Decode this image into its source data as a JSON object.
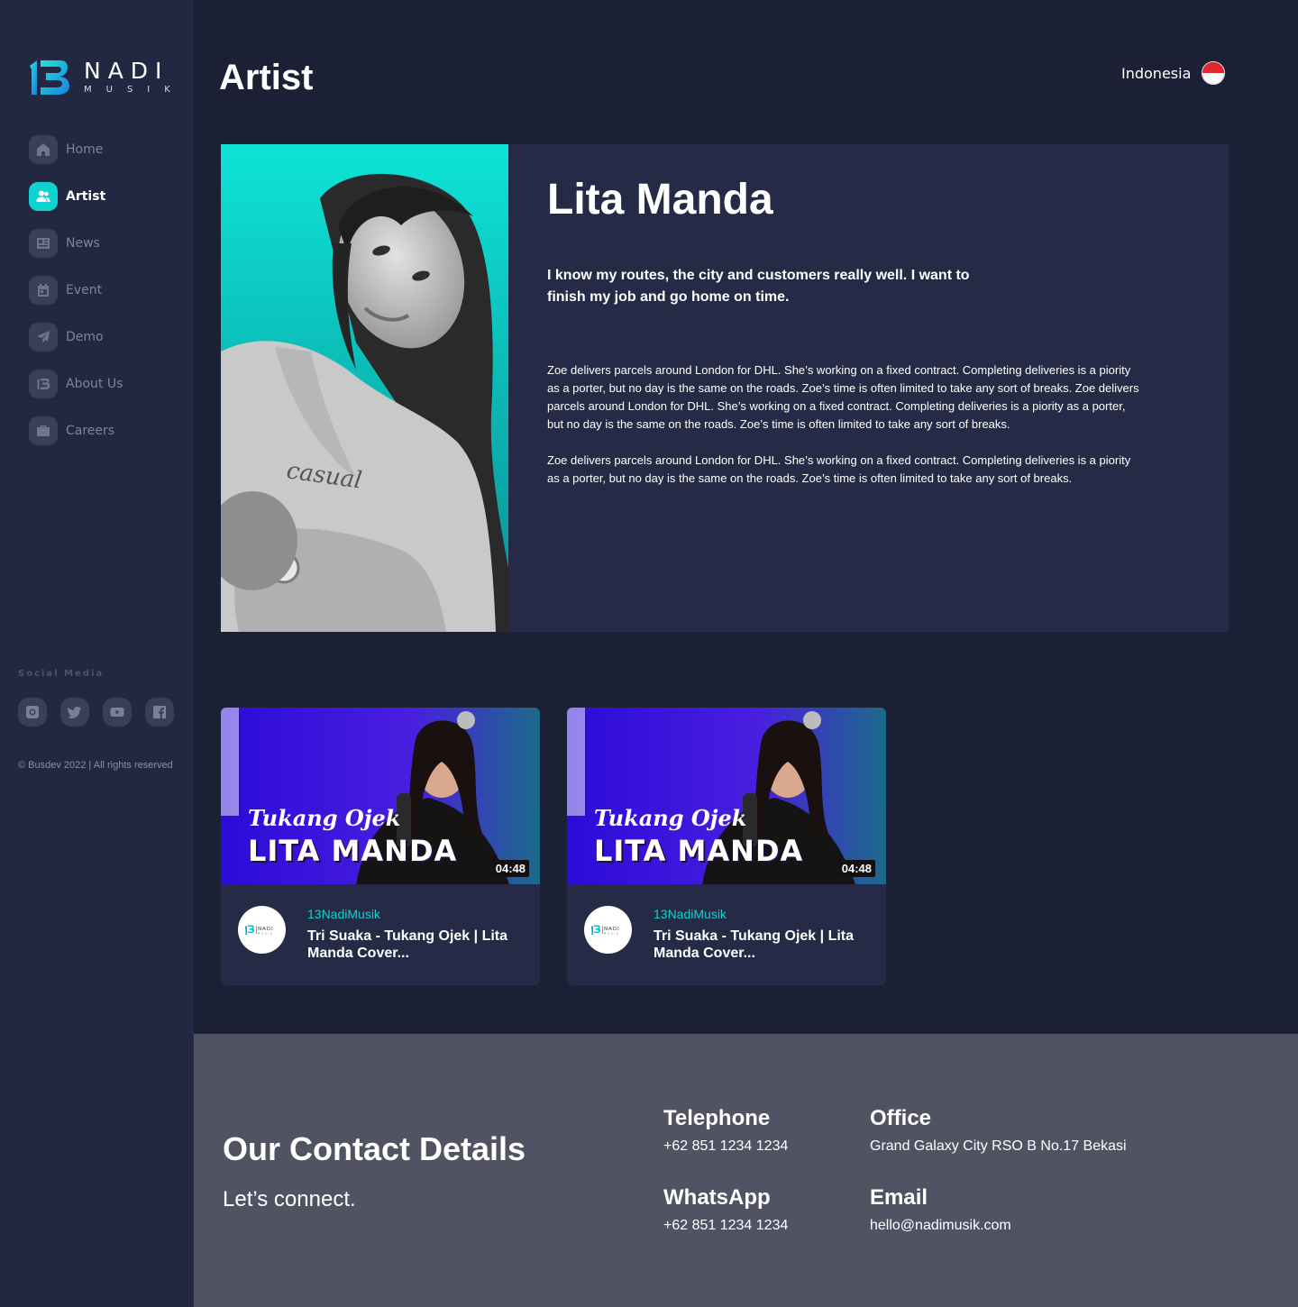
{
  "brand": {
    "name": "NADI",
    "tagline": "MUSIK",
    "accent_color": "#10d2d0"
  },
  "sidebar": {
    "items": [
      {
        "label": "Home",
        "icon": "home-icon",
        "active": false
      },
      {
        "label": "Artist",
        "icon": "users-icon",
        "active": true
      },
      {
        "label": "News",
        "icon": "newspaper-icon",
        "active": false
      },
      {
        "label": "Event",
        "icon": "calendar-icon",
        "active": false
      },
      {
        "label": "Demo",
        "icon": "send-icon",
        "active": false
      },
      {
        "label": "About Us",
        "icon": "brand-13-icon",
        "active": false
      },
      {
        "label": "Careers",
        "icon": "briefcase-icon",
        "active": false
      }
    ],
    "social_title": "Social Media",
    "social": [
      {
        "icon": "instagram-icon"
      },
      {
        "icon": "twitter-icon"
      },
      {
        "icon": "youtube-icon"
      },
      {
        "icon": "facebook-icon"
      }
    ],
    "copyright": "© Busdev 2022 | All rights reserved"
  },
  "header": {
    "title": "Artist",
    "language": "Indonesia",
    "flag_icon": "indonesia-flag-icon"
  },
  "artist": {
    "name": "Lita Manda",
    "quote": "I know my routes, the city and customers really well. I want to finish my job and go home on time.",
    "bio": [
      "Zoe delivers parcels around London for DHL. She’s working on a fixed contract. Completing deliveries is a piority as a porter, but no day is the same on the roads. Zoe’s time is often limited to take any sort of breaks. Zoe delivers parcels around London for DHL. She’s working on a fixed contract. Completing deliveries is a piority as a porter, but no day is the same on the roads. Zoe’s time is often limited to take any sort of breaks.",
      "Zoe delivers parcels around London for DHL. She’s working on a fixed contract. Completing deliveries is a piority as a porter, but no day is the same on the roads. Zoe’s time is often limited to take any sort of breaks."
    ]
  },
  "videos": [
    {
      "thumb_small": "Tukang Ojek",
      "thumb_big": "LITA MANDA",
      "duration": "04:48",
      "channel": "13NadiMusik",
      "title": "Tri Suaka - Tukang Ojek | Lita Manda Cover..."
    },
    {
      "thumb_small": "Tukang Ojek",
      "thumb_big": "LITA MANDA",
      "duration": "04:48",
      "channel": "13NadiMusik",
      "title": "Tri Suaka - Tukang Ojek | Lita Manda Cover..."
    }
  ],
  "footer": {
    "title": "Our Contact Details",
    "subtitle": "Let’s connect.",
    "telephone": {
      "label": "Telephone",
      "value": "+62 851 1234 1234"
    },
    "office": {
      "label": "Office",
      "value": "Grand Galaxy City RSO B No.17 Bekasi"
    },
    "whatsapp": {
      "label": "WhatsApp",
      "value": "+62 851 1234 1234"
    },
    "email": {
      "label": "Email",
      "value": "hello@nadimusik.com"
    }
  }
}
